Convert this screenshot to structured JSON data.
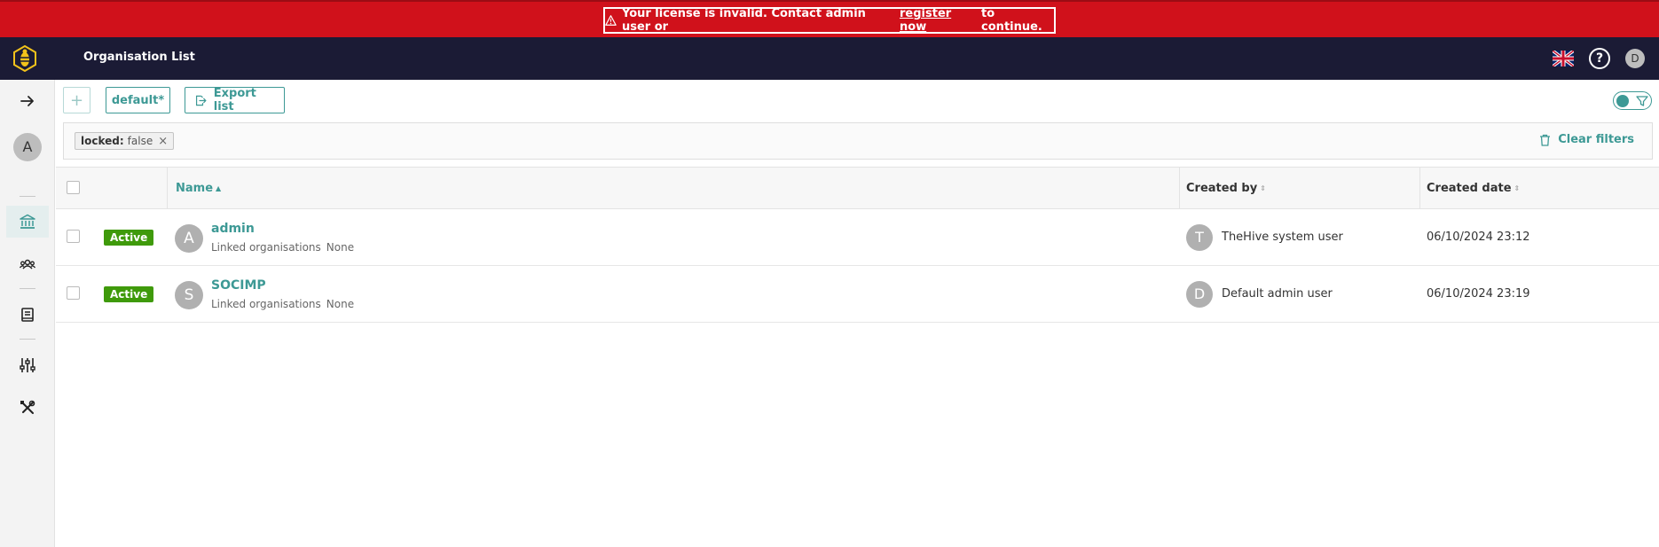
{
  "banner": {
    "text_before": "Your license is invalid. Contact admin user or",
    "link": "register now",
    "text_after": "to continue."
  },
  "header": {
    "title": "Organisation List",
    "user_initial": "D",
    "help_label": "?"
  },
  "sidebar": {
    "user_initial": "A"
  },
  "toolbar": {
    "add_label": "+",
    "view_label": "default*",
    "export_label": "Export list"
  },
  "filters": {
    "chip_key": "locked:",
    "chip_value": "false",
    "chip_close": "×",
    "clear_label": "Clear filters"
  },
  "table": {
    "columns": {
      "name": "Name",
      "created_by": "Created by",
      "created_date": "Created date"
    },
    "rows": [
      {
        "status": "Active",
        "initial": "A",
        "name": "admin",
        "linked_label": "Linked organisations",
        "linked_value": "None",
        "creator_initial": "T",
        "creator": "TheHive system user",
        "date": "06/10/2024 23:12"
      },
      {
        "status": "Active",
        "initial": "S",
        "name": "SOCIMP",
        "linked_label": "Linked organisations",
        "linked_value": "None",
        "creator_initial": "D",
        "creator": "Default admin user",
        "date": "06/10/2024 23:19"
      }
    ]
  },
  "colors": {
    "banner": "#d0111b",
    "header": "#1b1b35",
    "accent": "#3d9995",
    "active_badge": "#3f9a0b"
  }
}
